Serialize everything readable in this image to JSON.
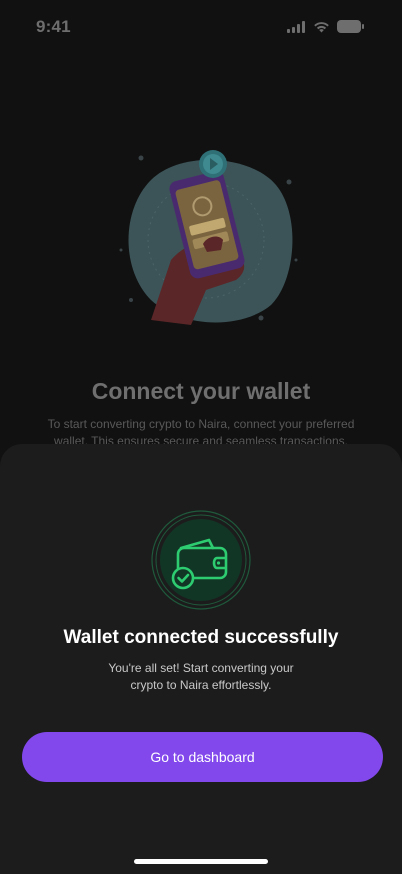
{
  "status_bar": {
    "time": "9:41",
    "signal_icon": "cellular-signal-icon",
    "wifi_icon": "wifi-icon",
    "battery_icon": "battery-icon"
  },
  "background_page": {
    "title": "Connect your wallet",
    "description": "To start converting crypto to Naira, connect your preferred wallet. This ensures secure and seamless transactions.",
    "illustration": "hand-holding-phone-illustration"
  },
  "modal": {
    "icon": "wallet-check-icon",
    "title": "Wallet connected successfully",
    "description": "You're all set! Start converting your crypto to Naira effortlessly.",
    "primary_button_label": "Go to dashboard"
  },
  "colors": {
    "accent": "#8248ec",
    "success": "#2ecc71",
    "sheet_background": "#1c1c1c",
    "page_background": "#111111"
  }
}
